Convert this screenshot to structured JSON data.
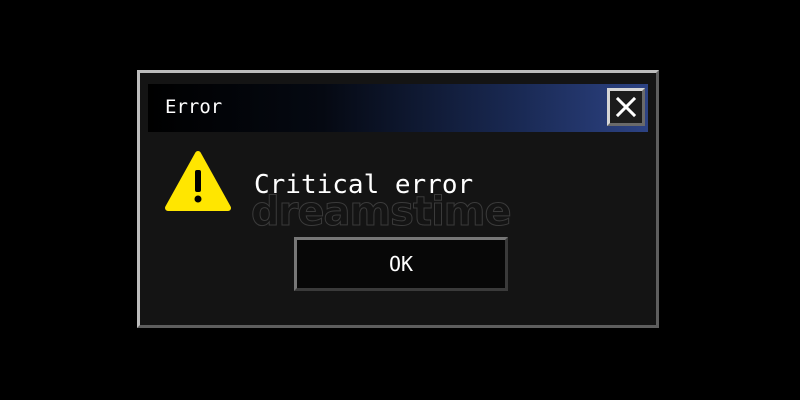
{
  "dialog": {
    "title": "Error",
    "message": "Critical error",
    "ok_label": "OK",
    "close_glyph": "✕",
    "icons": {
      "close": "close-icon",
      "warning": "warning-icon"
    }
  },
  "watermark": "dreamstime",
  "colors": {
    "background": "#000000",
    "dialog_body": "#141414",
    "titlebar_gradient_end": "#2d4384",
    "warning_fill": "#ffe600",
    "text": "#ffffff"
  }
}
